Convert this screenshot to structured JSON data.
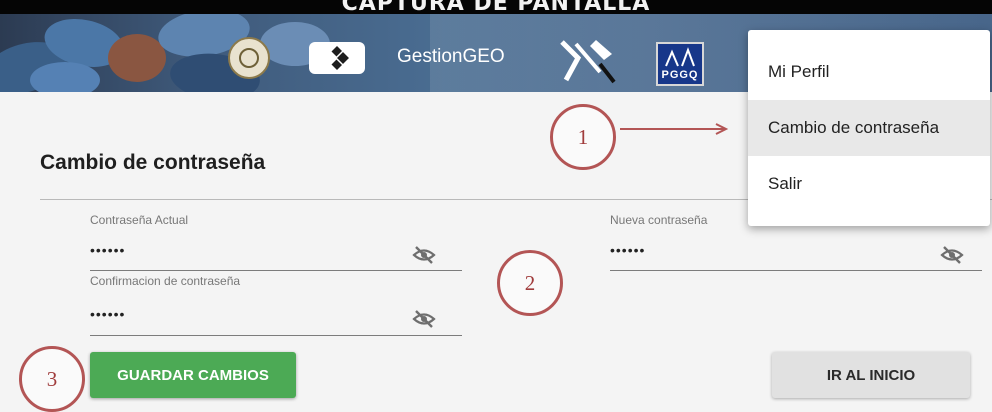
{
  "header": {
    "top_title": "CAPTURA DE PANTALLA",
    "app_name": "GestionGEO",
    "org_logo_text": "PGGQ",
    "menu_toggle_icon": "chevron-down-icon"
  },
  "form": {
    "title": "Cambio de contraseña",
    "fields": [
      {
        "label": "Contraseña Actual",
        "value": "••••••",
        "icon": "eye-off-icon"
      },
      {
        "label": "Nueva contraseña",
        "value": "••••••",
        "icon": "eye-off-icon"
      },
      {
        "label": "Confirmacion de contraseña",
        "value": "••••••",
        "icon": "eye-off-icon"
      }
    ]
  },
  "buttons": {
    "save_label": "GUARDAR CAMBIOS",
    "home_label": "IR AL INICIO"
  },
  "user_menu": {
    "items": [
      {
        "label": "Mi Perfil"
      },
      {
        "label": "Cambio de contraseña"
      },
      {
        "label": "Salir"
      }
    ]
  },
  "annotations": {
    "steps": [
      "1",
      "2",
      "3"
    ],
    "color": "#b35555"
  },
  "colors": {
    "primary_button": "#4caa55",
    "secondary_button": "#e1e1e1",
    "menu_highlight": "#e8e8e8"
  }
}
